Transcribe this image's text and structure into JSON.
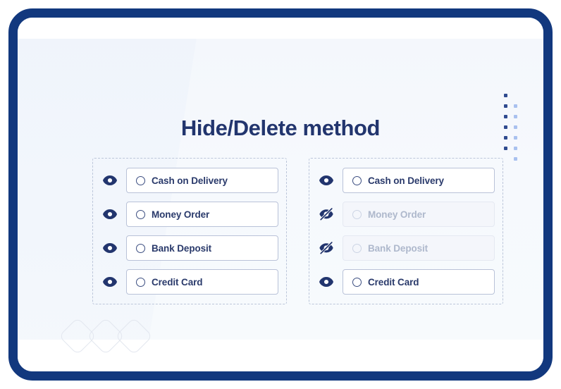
{
  "page": {
    "title": "Hide/Delete method",
    "frame_color": "#12387e",
    "title_color": "#22356e",
    "background_color": "#f6f9fc"
  },
  "decorations": {
    "dot_grid": {
      "name": "dot-grid",
      "dark_color": "#2f4b8f",
      "light_color": "#a9c1ef",
      "rows": 6
    },
    "diamonds": {
      "name": "diamond-watermark",
      "count": 3,
      "color": "#e3e7ef"
    }
  },
  "panels": [
    {
      "name": "panel-before",
      "rows": [
        {
          "label": "Cash on Delivery",
          "visible": true,
          "icon": "eye-icon"
        },
        {
          "label": "Money Order",
          "visible": true,
          "icon": "eye-icon"
        },
        {
          "label": "Bank Deposit",
          "visible": true,
          "icon": "eye-icon"
        },
        {
          "label": "Credit Card",
          "visible": true,
          "icon": "eye-icon"
        }
      ]
    },
    {
      "name": "panel-after",
      "rows": [
        {
          "label": "Cash on Delivery",
          "visible": true,
          "icon": "eye-icon"
        },
        {
          "label": "Money Order",
          "visible": false,
          "icon": "eye-slash-icon"
        },
        {
          "label": "Bank Deposit",
          "visible": false,
          "icon": "eye-slash-icon"
        },
        {
          "label": "Credit Card",
          "visible": true,
          "icon": "eye-icon"
        }
      ]
    }
  ]
}
